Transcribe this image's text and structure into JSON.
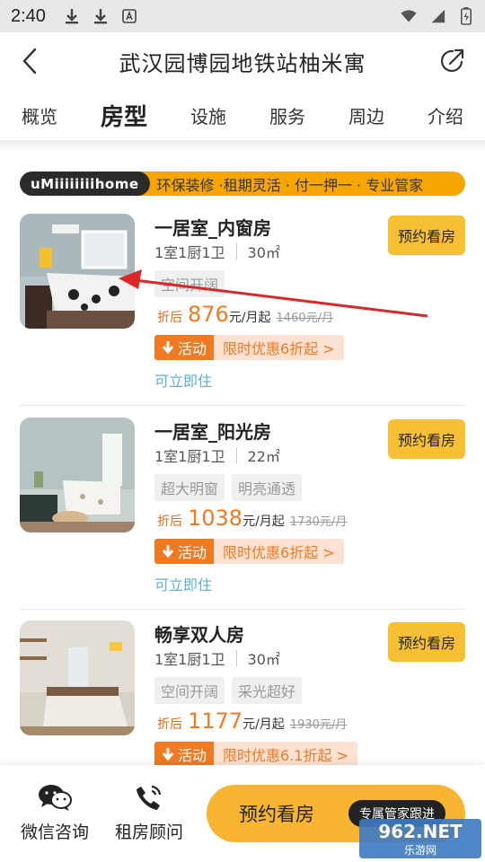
{
  "status_bar": {
    "time": "2:40"
  },
  "header": {
    "title": "武汉园博园地铁站柚米寓"
  },
  "tabs": [
    "概览",
    "房型",
    "设施",
    "服务",
    "周边",
    "介绍"
  ],
  "banner": {
    "logo": "uMiiiiiiiihome",
    "slogan": "环保装修 ·租期灵活 · 付一押一 · 专业管家"
  },
  "rooms": [
    {
      "name": "一居室_内窗房",
      "layout": "1室1厨1卫",
      "area": "30㎡",
      "tags": [
        "空间开阔"
      ],
      "price_prefix": "折后",
      "price": "876",
      "price_unit": "元/月起",
      "original_price": "1460元/月",
      "activity_label": "活动",
      "discount": "限时优惠6折起 >",
      "availability": "可立即住",
      "book_label": "预约看房"
    },
    {
      "name": "一居室_阳光房",
      "layout": "1室1厨1卫",
      "area": "22㎡",
      "tags": [
        "超大明窗",
        "明亮通透"
      ],
      "price_prefix": "折后",
      "price": "1038",
      "price_unit": "元/月起",
      "original_price": "1730元/月",
      "activity_label": "活动",
      "discount": "限时优惠6折起 >",
      "availability": "可立即住",
      "book_label": "预约看房"
    },
    {
      "name": "畅享双人房",
      "layout": "1室1厨1卫",
      "area": "30㎡",
      "tags": [
        "空间开阔",
        "采光超好"
      ],
      "price_prefix": "折后",
      "price": "1177",
      "price_unit": "元/月起",
      "original_price": "1930元/月",
      "activity_label": "活动",
      "discount": "限时优惠6.1折起 >",
      "availability": "",
      "book_label": "预约看房"
    }
  ],
  "bottom_bar": {
    "wechat_label": "微信咨询",
    "advisor_label": "租房顾问",
    "cta_label": "预约看房",
    "cta_pill": "专属管家跟进"
  },
  "watermark": {
    "line1": "962.NET",
    "line2": "乐游网"
  },
  "colors": {
    "accent_orange": "#f07a22",
    "button_yellow": "#f7c034",
    "banner_orange": "#f7a600",
    "available_blue": "#5bb0d6"
  }
}
